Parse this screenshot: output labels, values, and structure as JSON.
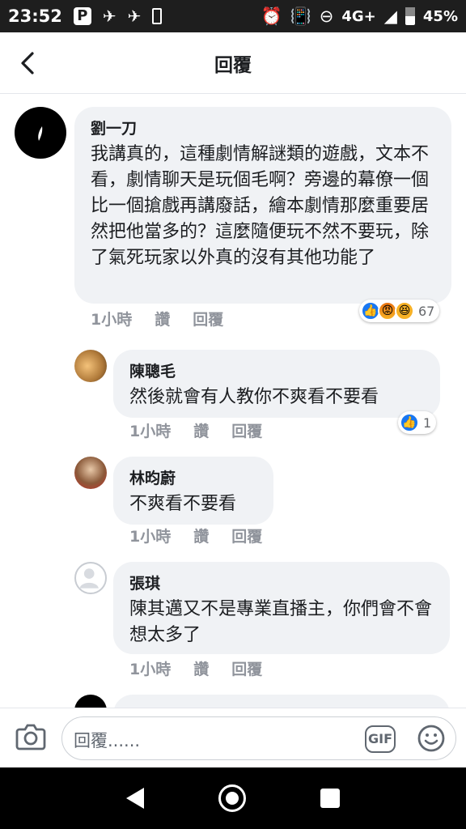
{
  "status_bar": {
    "time": "23:52",
    "network": "4G+",
    "battery": "45%"
  },
  "header": {
    "title": "回覆"
  },
  "comments": [
    {
      "name": "劉一刀",
      "text": "我講真的，這種劇情解謎類的遊戲，文本不看，劇情聊天是玩個毛啊？旁邊的幕僚一個比一個搶戲再講廢話，繪本劇情那麼重要居然把他當多的？這麼隨便玩不然不要玩，除了氣死玩家以外真的沒有其他功能了",
      "time": "1小時",
      "like": "讚",
      "reply": "回覆",
      "reaction_count": "67"
    },
    {
      "name": "陳聰毛",
      "text": "然後就會有人教你不爽看不要看",
      "time": "1小時",
      "like": "讚",
      "reply": "回覆",
      "reaction_count": "1"
    },
    {
      "name": "林昀蔚",
      "text": "不爽看不要看",
      "time": "1小時",
      "like": "讚",
      "reply": "回覆"
    },
    {
      "name": "張琪",
      "text": "陳其邁又不是專業直播主，你們會不會想太多了",
      "time": "1小時",
      "like": "讚",
      "reply": "回覆"
    }
  ],
  "composer": {
    "placeholder": "回覆......",
    "gif_label": "GIF"
  },
  "colors": {
    "bubble": "#f0f2f5",
    "like_blue": "#1877f2",
    "meta_gray": "#90949c"
  }
}
